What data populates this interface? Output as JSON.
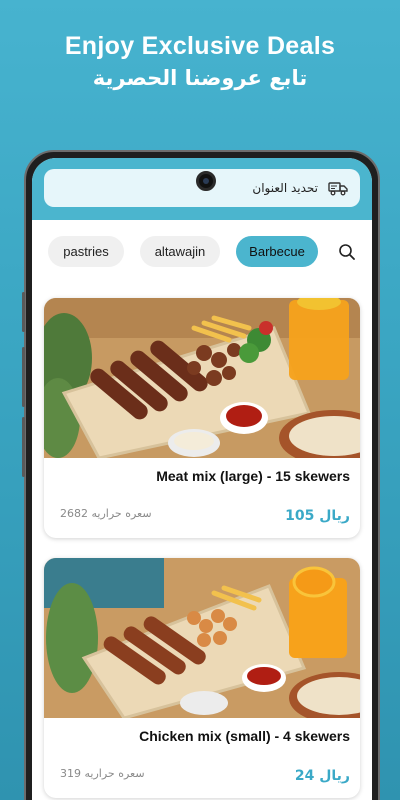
{
  "promo": {
    "title": "Enjoy Exclusive Deals",
    "subtitle": "تابع عروضنا الحصرية"
  },
  "header": {
    "address_label": "تحديد العنوان",
    "icon": "delivery-truck-icon",
    "accent_color": "#4bb5ce"
  },
  "tabs": [
    {
      "label": "pastries",
      "active": false
    },
    {
      "label": "altawajin",
      "active": false
    },
    {
      "label": "Barbecue",
      "active": true
    }
  ],
  "search": {
    "icon": "search-icon"
  },
  "products": [
    {
      "name": "Meat mix (large) - 15 skewers",
      "price": "105 ريال",
      "calories": "2682 سعره حراريه"
    },
    {
      "name": "Chicken mix (small) - 4 skewers",
      "price": "24 ريال",
      "calories": "319 سعره حراريه"
    }
  ]
}
